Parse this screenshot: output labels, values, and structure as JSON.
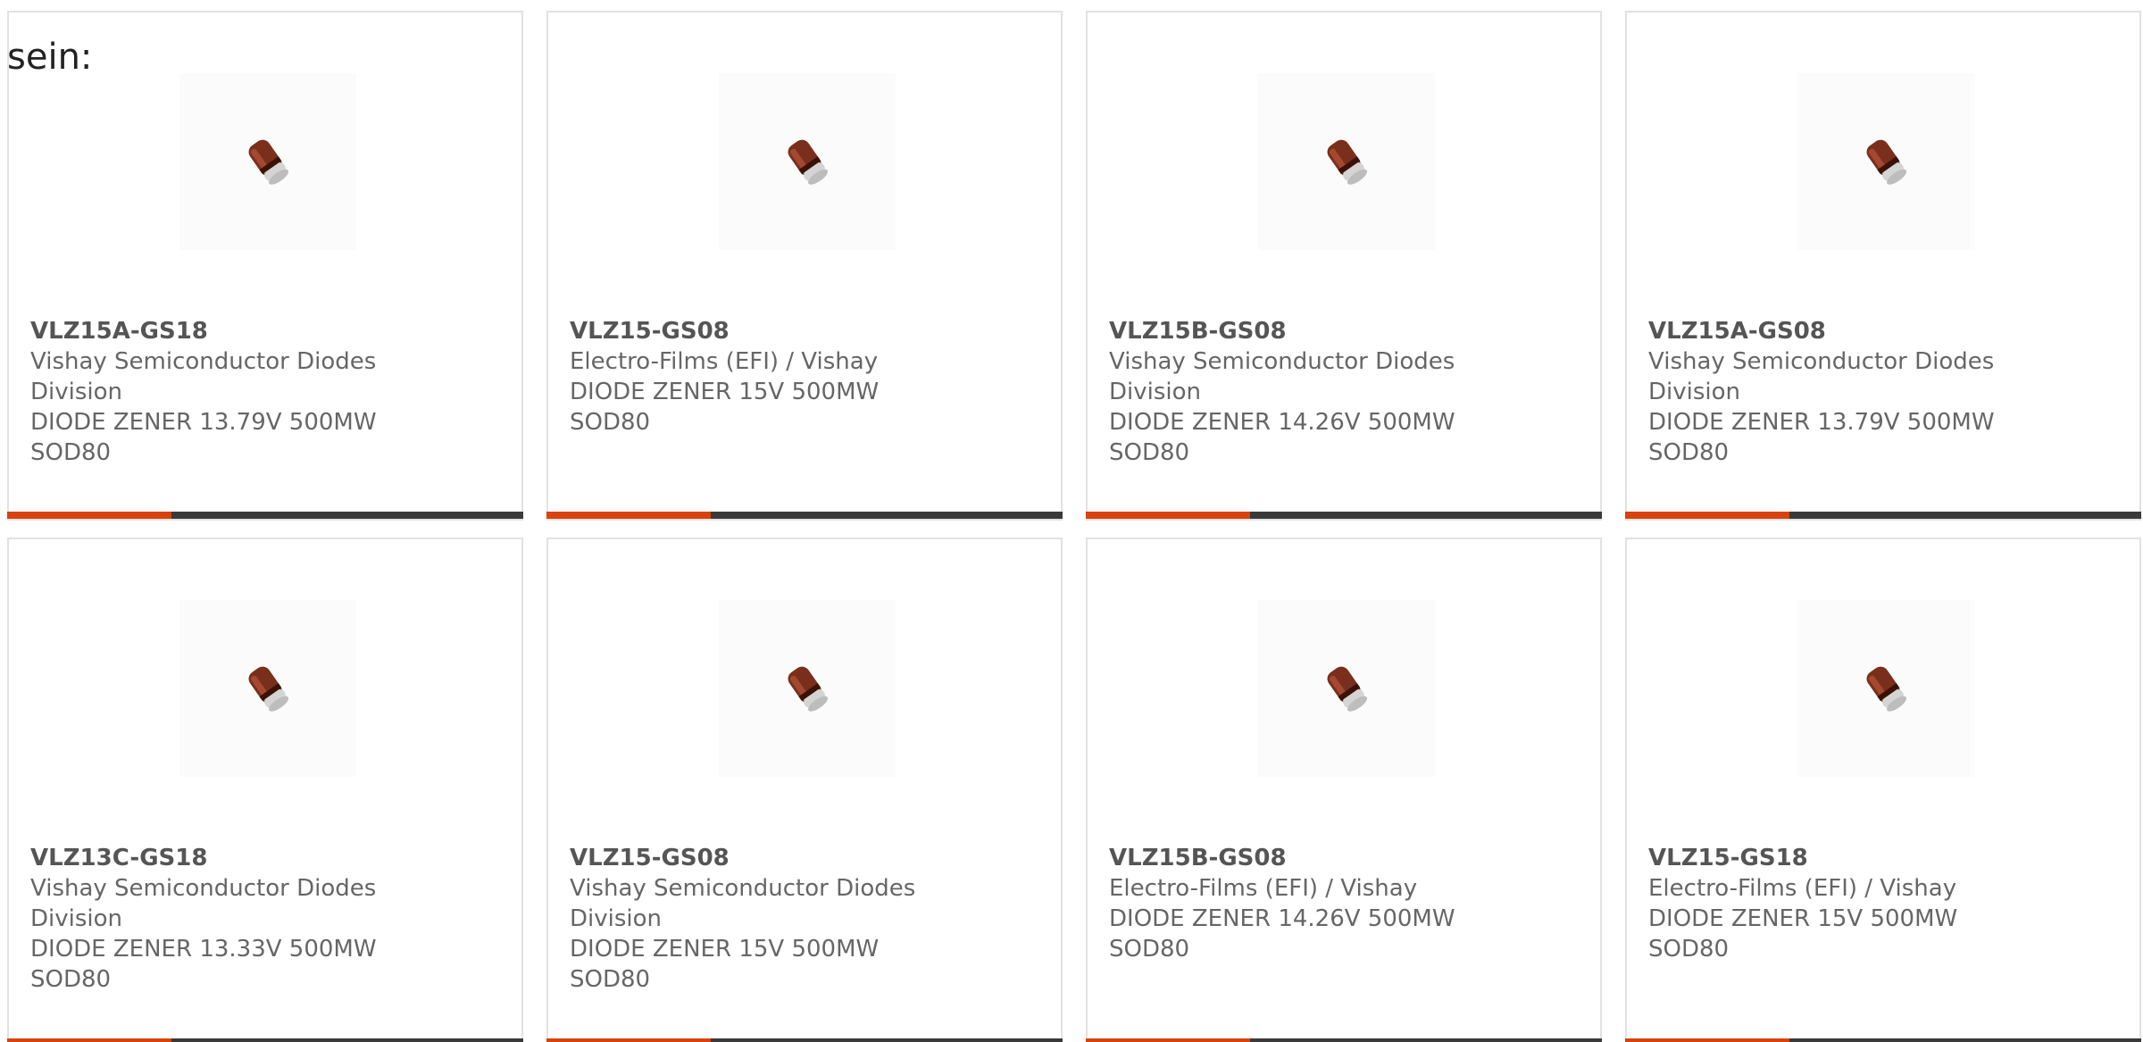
{
  "intro_text": "sein:",
  "colors": {
    "accent": "#d9420b",
    "bar": "#3a3a3a",
    "card_border": "#e2e2e2",
    "text": "#666666"
  },
  "products": [
    {
      "part_number": "VLZ15A-GS18",
      "manufacturer_line1": "Vishay Semiconductor Diodes",
      "manufacturer_line2": "Division",
      "description_line1": "DIODE ZENER 13.79V 500MW",
      "description_line2": "SOD80",
      "image_icon": "zener-diode-icon"
    },
    {
      "part_number": "VLZ15-GS08",
      "manufacturer_line1": "Electro-Films (EFI) / Vishay",
      "manufacturer_line2": "",
      "description_line1": "DIODE ZENER 15V 500MW",
      "description_line2": "SOD80",
      "image_icon": "zener-diode-icon"
    },
    {
      "part_number": "VLZ15B-GS08",
      "manufacturer_line1": "Vishay Semiconductor Diodes",
      "manufacturer_line2": "Division",
      "description_line1": "DIODE ZENER 14.26V 500MW",
      "description_line2": "SOD80",
      "image_icon": "zener-diode-icon"
    },
    {
      "part_number": "VLZ15A-GS08",
      "manufacturer_line1": "Vishay Semiconductor Diodes",
      "manufacturer_line2": "Division",
      "description_line1": "DIODE ZENER 13.79V 500MW",
      "description_line2": "SOD80",
      "image_icon": "zener-diode-icon"
    },
    {
      "part_number": "VLZ13C-GS18",
      "manufacturer_line1": "Vishay Semiconductor Diodes",
      "manufacturer_line2": "Division",
      "description_line1": "DIODE ZENER 13.33V 500MW",
      "description_line2": "SOD80",
      "image_icon": "zener-diode-icon"
    },
    {
      "part_number": "VLZ15-GS08",
      "manufacturer_line1": "Vishay Semiconductor Diodes",
      "manufacturer_line2": "Division",
      "description_line1": "DIODE ZENER 15V 500MW",
      "description_line2": "SOD80",
      "image_icon": "zener-diode-icon"
    },
    {
      "part_number": "VLZ15B-GS08",
      "manufacturer_line1": "Electro-Films (EFI) / Vishay",
      "manufacturer_line2": "",
      "description_line1": "DIODE ZENER 14.26V 500MW",
      "description_line2": "SOD80",
      "image_icon": "zener-diode-icon"
    },
    {
      "part_number": "VLZ15-GS18",
      "manufacturer_line1": "Electro-Films (EFI) / Vishay",
      "manufacturer_line2": "",
      "description_line1": "DIODE ZENER 15V 500MW",
      "description_line2": "SOD80",
      "image_icon": "zener-diode-icon"
    }
  ]
}
